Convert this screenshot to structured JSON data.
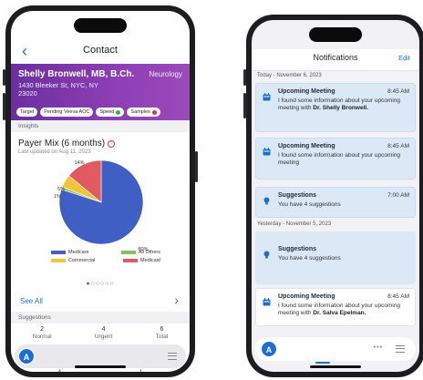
{
  "left_phone": {
    "nav": {
      "back_icon": "chevron-left-icon",
      "title": "Contact"
    },
    "contact": {
      "name": "Shelly Bronwell, MB, B.Ch.",
      "specialty": "Neurology",
      "address_line1": "1430 Bleeker St, NYC, NY",
      "address_line2": "23020",
      "pills": [
        {
          "label": "Target"
        },
        {
          "label": "Pending Veeva AOC"
        },
        {
          "label": "Speed",
          "status_color": "#2fb34a"
        },
        {
          "label": "Samples",
          "status_color": "#e0303a"
        }
      ]
    },
    "insights_label": "Insights",
    "card": {
      "title": "Payer Mix (6 months)",
      "updated": "Last updated on Aug 11, 2023"
    },
    "chart_data": {
      "type": "pie",
      "title": "Payer Mix (6 months)",
      "slices": [
        {
          "name": "Medicare",
          "value": 80,
          "label": "80%",
          "color": "#3f5fc4"
        },
        {
          "name": "All Others",
          "value": 1,
          "label": "1%",
          "color": "#7fc35a"
        },
        {
          "name": "Commercial",
          "value": 5,
          "label": "5%",
          "color": "#f4c33c"
        },
        {
          "name": "Medicaid",
          "value": 14,
          "label": "14%",
          "color": "#e05a5f"
        }
      ],
      "legend_placement": "bottom"
    },
    "pager_dots": "●○○○○○",
    "see_all": "See All",
    "suggestions_label": "Suggestions",
    "suggestion_stats": [
      {
        "value": "2",
        "label": "Normal"
      },
      {
        "value": "4",
        "label": "Urgent"
      },
      {
        "value": "6",
        "label": "Total"
      }
    ],
    "avatar_letter": "A",
    "bottom_numbers": [
      "4",
      "1"
    ]
  },
  "right_phone": {
    "nav": {
      "title": "Notifications",
      "edit": "Edit"
    },
    "today_header": "Today - November 6, 2023",
    "yesterday_header": "Yesterday - November 5, 2023",
    "notifications": [
      {
        "icon": "calendar-icon",
        "title": "Upcoming Meeting",
        "time": "8:45 AM",
        "body": "I found some information about your upcoming meeting with ",
        "body_bold": "Dr. Shelly Bronwell."
      },
      {
        "icon": "calendar-icon",
        "title": "Upcoming Meeting",
        "time": "8:45 AM",
        "body": "I found some information about your upcoming meeting",
        "body_bold": ""
      },
      {
        "icon": "lightbulb-icon",
        "title": "Suggestions",
        "time": "7:00 AM",
        "body": "You have 4 suggestions",
        "body_bold": ""
      },
      {
        "icon": "lightbulb-icon",
        "title": "Suggestions",
        "time": "",
        "body": "You have 4 suggestions",
        "body_bold": ""
      },
      {
        "icon": "calendar-icon",
        "title": "Upcoming Meeting",
        "time": "8:45 AM",
        "body": "I found some information about your upcoming meeting with ",
        "body_bold": "Dr. Salva Epelman."
      }
    ],
    "avatar_letter": "A",
    "more_icon": "•••"
  }
}
